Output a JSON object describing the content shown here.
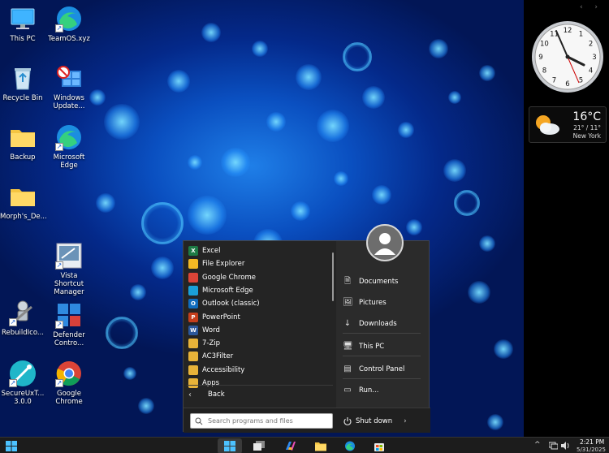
{
  "desktop": {
    "icons": [
      {
        "name": "this-pc-icon",
        "label": "This PC"
      },
      {
        "name": "teamos-icon",
        "label": "TeamOS.xyz"
      },
      {
        "name": "recycle-bin-icon",
        "label": "Recycle Bin"
      },
      {
        "name": "windows-update-icon",
        "label": "Windows Update..."
      },
      {
        "name": "backup-folder-icon",
        "label": "Backup"
      },
      {
        "name": "microsoft-edge-icon",
        "label": "Microsoft Edge"
      },
      {
        "name": "morphs-folder-icon",
        "label": "Morph's_De..."
      },
      {
        "name": "vista-shortcut-manager-icon",
        "label": "Vista Shortcut Manager"
      },
      {
        "name": "rebuildicon-icon",
        "label": "RebuildIco..."
      },
      {
        "name": "defender-control-icon",
        "label": "Defender Contro..."
      },
      {
        "name": "secureuxtheme-icon",
        "label": "SecureUxT... 3.0.0"
      },
      {
        "name": "google-chrome-icon",
        "label": "Google Chrome"
      }
    ]
  },
  "sidepanel": {
    "arrows": "‹ ›",
    "clock": {
      "numbers": [
        "12",
        "1",
        "2",
        "3",
        "4",
        "5",
        "6",
        "7",
        "8",
        "9",
        "10",
        "11"
      ]
    },
    "weather": {
      "temp": "16°C",
      "range": "21° / 11°",
      "city": "New York"
    }
  },
  "startmenu": {
    "programs": [
      {
        "label": "Excel",
        "icon": "excel-icon",
        "color": "#1d7a45",
        "glyph": "X"
      },
      {
        "label": "File Explorer",
        "icon": "file-explorer-icon",
        "color": "#f2b824",
        "glyph": ""
      },
      {
        "label": "Google Chrome",
        "icon": "chrome-icon",
        "color": "#db4437",
        "glyph": ""
      },
      {
        "label": "Microsoft Edge",
        "icon": "edge-icon",
        "color": "#1aa0d8",
        "glyph": ""
      },
      {
        "label": "Outlook (classic)",
        "icon": "outlook-icon",
        "color": "#0f6cbd",
        "glyph": "O"
      },
      {
        "label": "PowerPoint",
        "icon": "powerpoint-icon",
        "color": "#c43e1c",
        "glyph": "P"
      },
      {
        "label": "Word",
        "icon": "word-icon",
        "color": "#2b579a",
        "glyph": "W"
      },
      {
        "label": "7-Zip",
        "icon": "folder-icon",
        "color": "#e8b339",
        "glyph": ""
      },
      {
        "label": "AC3Filter",
        "icon": "folder-icon",
        "color": "#e8b339",
        "glyph": ""
      },
      {
        "label": "Accessibility",
        "icon": "folder-icon",
        "color": "#e8b339",
        "glyph": ""
      },
      {
        "label": "Apps",
        "icon": "folder-icon",
        "color": "#e8b339",
        "glyph": ""
      }
    ],
    "back_label": "Back",
    "right_items": [
      {
        "label": "Documents",
        "icon": "documents-icon",
        "glyph": "🗎"
      },
      {
        "label": "Pictures",
        "icon": "pictures-icon",
        "glyph": "🖼"
      },
      {
        "label": "Downloads",
        "icon": "downloads-icon",
        "glyph": "↓"
      },
      {
        "label": "This PC",
        "icon": "this-pc-icon",
        "glyph": "🖥"
      },
      {
        "label": "Control Panel",
        "icon": "control-panel-icon",
        "glyph": "▤"
      },
      {
        "label": "Run...",
        "icon": "run-icon",
        "glyph": "▭"
      }
    ],
    "search_placeholder": "Search programs and files",
    "shutdown_label": "Shut down"
  },
  "taskbar": {
    "tray_chevron": "^",
    "time": "2:21 PM",
    "date": "5/31/2025"
  }
}
